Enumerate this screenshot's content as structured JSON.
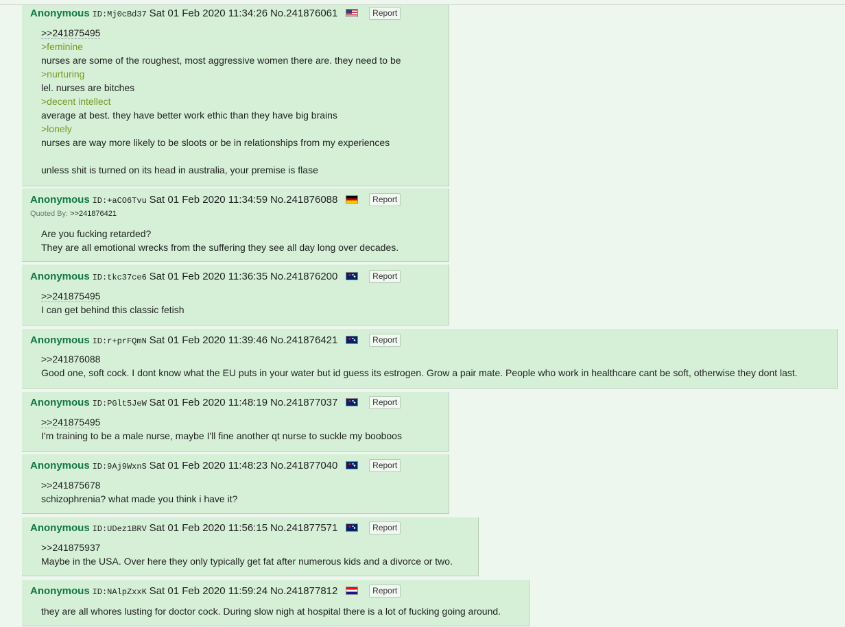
{
  "report_label": "Report",
  "quoted_by_label": "Quoted By:",
  "posts": [
    {
      "name": "Anonymous",
      "id": "ID:Mj0cBd37",
      "datetime": "Sat 01 Feb 2020 11:34:26",
      "no": "No.241876061",
      "flag": "us-flag",
      "lines": [
        ">>241875495",
        ">feminine",
        "nurses are some of the roughest, most aggressive women there are. they need to be",
        ">nurturing",
        "lel. nurses are bitches",
        ">decent intellect",
        "average at best. they have better work ethic than they have big brains",
        ">lonely",
        "nurses are way more likely to be sloots or be in relationships from my experiences",
        "",
        "unless shit is turned on its head in australia, your premise is flase"
      ]
    },
    {
      "name": "Anonymous",
      "id": "ID:+aCO6Tvu",
      "datetime": "Sat 01 Feb 2020 11:34:59",
      "no": "No.241876088",
      "flag": "germany-flag",
      "quoted_by": ">>241876421",
      "lines": [
        "Are you fucking retarded?",
        "They are all emotional wrecks from the suffering they see all day long over decades."
      ]
    },
    {
      "name": "Anonymous",
      "id": "ID:tkc37ce6",
      "datetime": "Sat 01 Feb 2020 11:36:35",
      "no": "No.241876200",
      "flag": "australia-flag",
      "lines": [
        ">>241875495",
        "I can get behind this classic fetish"
      ]
    },
    {
      "name": "Anonymous",
      "id": "ID:r+prFQmN",
      "datetime": "Sat 01 Feb 2020 11:39:46",
      "no": "No.241876421",
      "flag": "australia-flag",
      "lines": [
        ">>241876088",
        "Good one, soft cock. I dont know what the EU puts in your water but id guess its estrogen. Grow a pair mate. People who work in healthcare cant be soft, otherwise they dont last."
      ]
    },
    {
      "name": "Anonymous",
      "id": "ID:PGlt5JeW",
      "datetime": "Sat 01 Feb 2020 11:48:19",
      "no": "No.241877037",
      "flag": "australia-flag",
      "lines": [
        ">>241875495",
        "I'm training to be a male nurse, maybe I'll fine another qt nurse to suckle my booboos"
      ]
    },
    {
      "name": "Anonymous",
      "id": "ID:9Aj9WxnS",
      "datetime": "Sat 01 Feb 2020 11:48:23",
      "no": "No.241877040",
      "flag": "australia-flag",
      "lines": [
        ">>241875678",
        "schizophrenia? what made you think i have it?"
      ]
    },
    {
      "name": "Anonymous",
      "id": "ID:UDez1BRV",
      "datetime": "Sat 01 Feb 2020 11:56:15",
      "no": "No.241877571",
      "flag": "australia-flag",
      "lines": [
        ">>241875937",
        "Maybe in the USA. Over here they only typically get fat after numerous kids and a divorce or two."
      ]
    },
    {
      "name": "Anonymous",
      "id": "ID:NAlpZxxK",
      "datetime": "Sat 01 Feb 2020 11:59:24",
      "no": "No.241877812",
      "flag": "croatia-flag",
      "lines": [
        "they are all whores lusting for doctor cock. During slow nigh at hospital there is a lot of fucking going around."
      ]
    }
  ]
}
